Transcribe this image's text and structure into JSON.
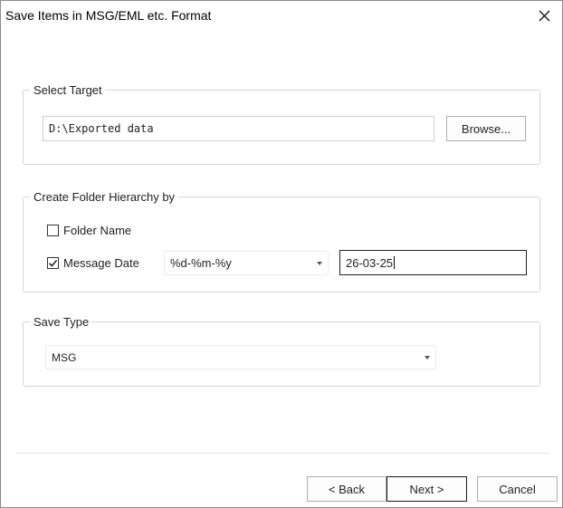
{
  "window": {
    "title": "Save Items in MSG/EML etc. Format"
  },
  "select_target": {
    "legend": "Select Target",
    "path_value": "D:\\Exported data",
    "browse_label": "Browse..."
  },
  "folder_hierarchy": {
    "legend": "Create Folder Hierarchy by",
    "folder_name_label": "Folder Name",
    "folder_name_checked": false,
    "message_date_label": "Message Date",
    "message_date_checked": true,
    "date_format_selected": "%d-%m-%y",
    "date_preview_value": "26-03-25"
  },
  "save_type": {
    "legend": "Save Type",
    "selected": "MSG"
  },
  "footer": {
    "back_label": "< Back",
    "next_label": "Next >",
    "cancel_label": "Cancel"
  }
}
